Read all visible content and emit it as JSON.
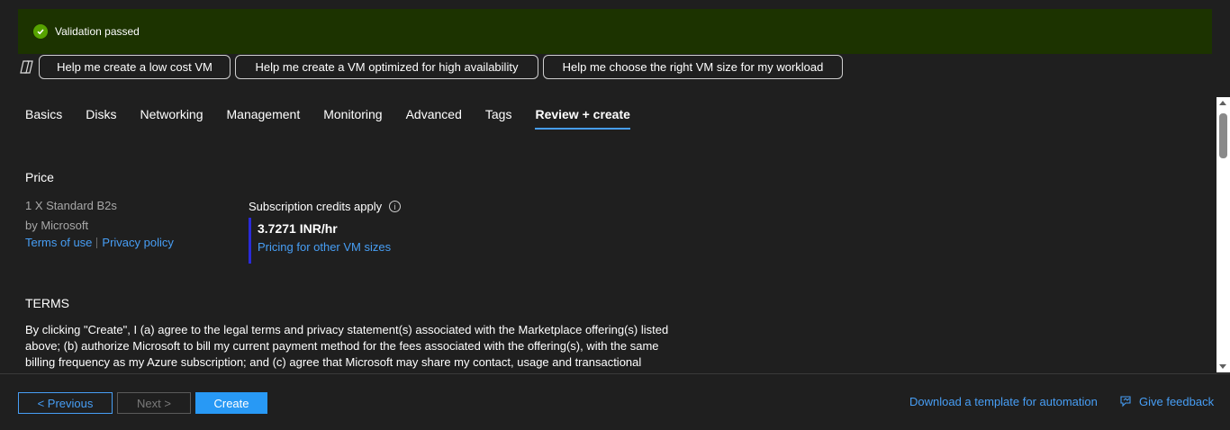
{
  "banner": {
    "text": "Validation passed"
  },
  "copilot": {
    "icon": "copilot-icon",
    "prompts": [
      "Help me create a low cost VM",
      "Help me create a VM optimized for high availability",
      "Help me choose the right VM size for my workload"
    ]
  },
  "tabs": [
    "Basics",
    "Disks",
    "Networking",
    "Management",
    "Monitoring",
    "Advanced",
    "Tags",
    "Review + create"
  ],
  "active_tab": "Review + create",
  "price": {
    "heading": "Price",
    "product": "1 X Standard B2s",
    "publisher": "by Microsoft",
    "terms_of_use": "Terms of use",
    "privacy_policy": "Privacy policy",
    "credits_label": "Subscription credits apply",
    "amount": "3.7271 INR/hr",
    "pricing_link": "Pricing for other VM sizes"
  },
  "terms": {
    "heading": "TERMS",
    "body": "By clicking \"Create\", I (a) agree to the legal terms and privacy statement(s) associated with the Marketplace offering(s) listed above; (b) authorize Microsoft to bill my current payment method for the fees associated with the offering(s), with the same billing frequency as my Azure subscription; and (c) agree that Microsoft may share my contact, usage and transactional"
  },
  "footer": {
    "previous": "< Previous",
    "next": "Next >",
    "create": "Create",
    "download_template": "Download a template for automation",
    "feedback": "Give feedback"
  },
  "colors": {
    "background": "#1f1f1f",
    "banner_bg": "#1c3300",
    "success": "#57a300",
    "link": "#479ef5",
    "primary_button": "#2899f5",
    "price_accent": "#2a2ad8"
  }
}
